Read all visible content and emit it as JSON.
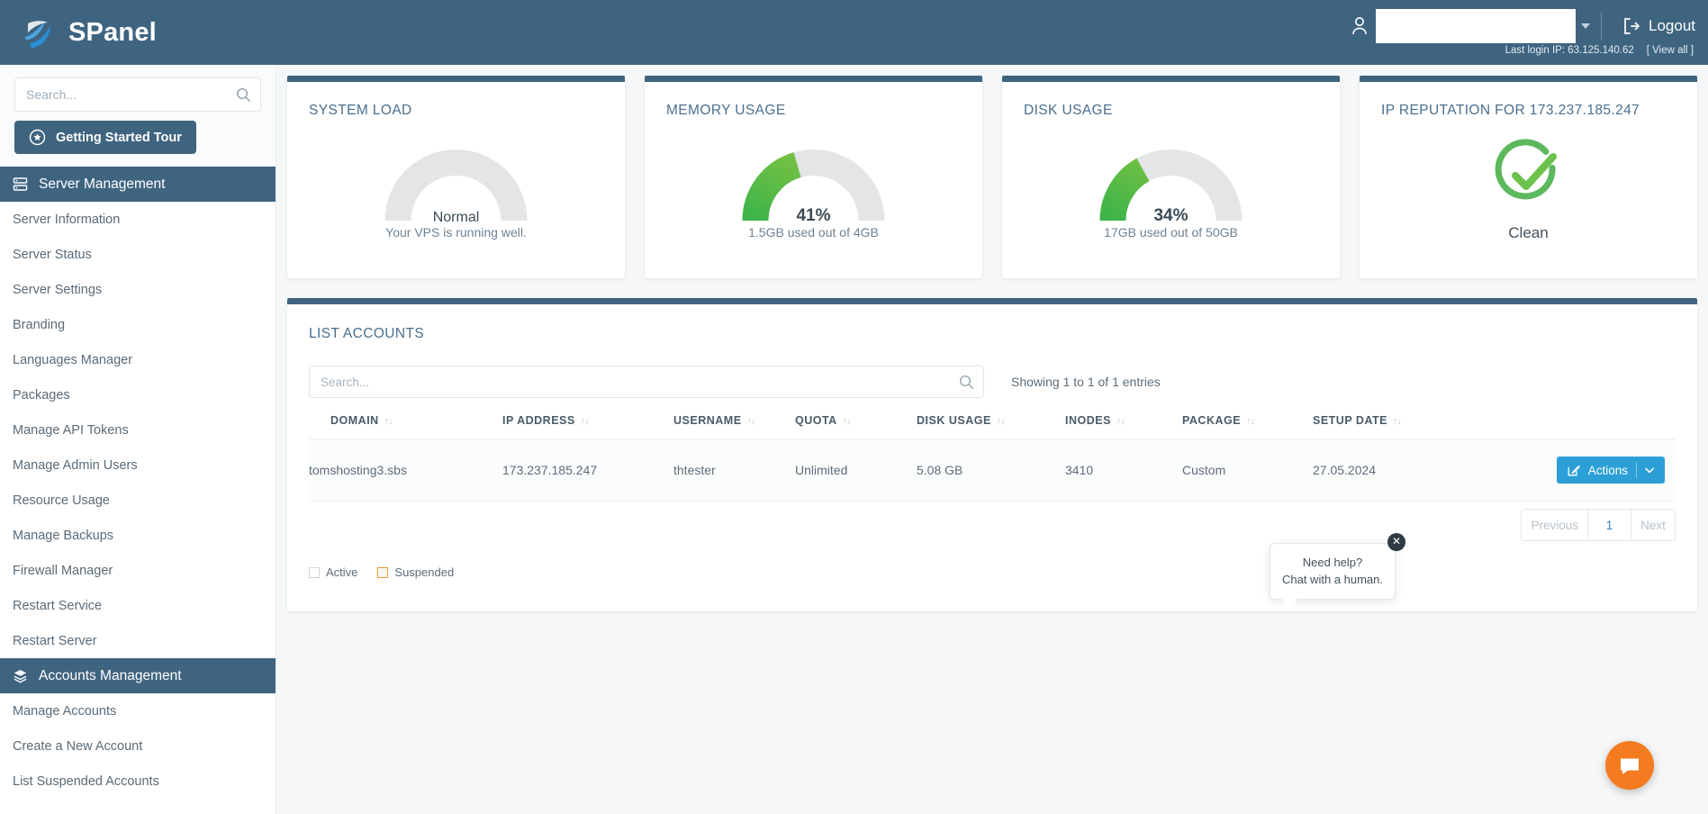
{
  "brand": {
    "name": "SPanel",
    "logo_icon": "spanel-logo-icon"
  },
  "topbar": {
    "user_icon": "user-icon",
    "user_select_value": "",
    "caret_icon": "chevron-down-icon",
    "logout_label": "Logout",
    "logout_icon": "logout-icon",
    "last_login_text": "Last login IP: 63.125.140.62",
    "view_all_label": "[ View all ]"
  },
  "sidebar": {
    "search_placeholder": "Search...",
    "search_value": "",
    "search_icon": "search-icon",
    "tour_button": {
      "label": "Getting Started Tour",
      "icon": "rocket-icon"
    },
    "groups": [
      {
        "label": "Server Management",
        "icon": "server-icon",
        "items": [
          "Server Information",
          "Server Status",
          "Server Settings",
          "Branding",
          "Languages Manager",
          "Packages",
          "Manage API Tokens",
          "Manage Admin Users",
          "Resource Usage",
          "Manage Backups",
          "Firewall Manager",
          "Restart Service",
          "Restart Server"
        ]
      },
      {
        "label": "Accounts Management",
        "icon": "layers-icon",
        "items": [
          "Manage Accounts",
          "Create a New Account",
          "List Suspended Accounts"
        ]
      }
    ]
  },
  "cards": [
    {
      "title": "SYSTEM LOAD",
      "type": "status-gauge",
      "percent": 0,
      "center_label": "Normal",
      "sub_label": "Your VPS is running well."
    },
    {
      "title": "MEMORY USAGE",
      "type": "percent-gauge",
      "percent": 41,
      "center_label": "41%",
      "sub_label": "1.5GB used out of 4GB"
    },
    {
      "title": "DISK USAGE",
      "type": "percent-gauge",
      "percent": 34,
      "center_label": "34%",
      "sub_label": "17GB used out of 50GB"
    },
    {
      "title": "IP REPUTATION FOR 173.237.185.247",
      "type": "reputation",
      "status_icon": "check-circle-icon",
      "status_label": "Clean"
    }
  ],
  "accounts_panel": {
    "title": "LIST ACCOUNTS",
    "search_placeholder": "Search...",
    "search_value": "",
    "search_icon": "search-icon",
    "entries_info": "Showing 1 to 1 of 1 entries",
    "sort_icon": "sort-updown-icon",
    "columns": [
      "DOMAIN",
      "IP ADDRESS",
      "USERNAME",
      "QUOTA",
      "DISK USAGE",
      "INODES",
      "PACKAGE",
      "SETUP DATE"
    ],
    "rows": [
      {
        "domain": "tomshosting3.sbs",
        "ip_address": "173.237.185.247",
        "username": "thtester",
        "quota": "Unlimited",
        "disk_usage": "5.08 GB",
        "inodes": "3410",
        "package": "Custom",
        "setup_date": "27.05.2024",
        "actions_label": "Actions",
        "actions_icon": "pencil-square-icon",
        "actions_caret": "chevron-down-icon"
      }
    ],
    "pagination": {
      "previous": "Previous",
      "page": "1",
      "next": "Next"
    },
    "legend": [
      {
        "label": "Active",
        "color": "#cfd7dd"
      },
      {
        "label": "Suspended",
        "color": "#f0932b"
      }
    ]
  },
  "chat": {
    "line1": "Need help?",
    "line2": "Chat with a human.",
    "close_icon": "close-icon",
    "fab_icon": "chat-bubble-icon"
  },
  "colors": {
    "header_blue": "#3f6480",
    "accent_blue": "#2b9fd6",
    "gauge_green_dark": "#4caf50",
    "gauge_green_light": "#8bc73f",
    "gauge_track": "#e3e5e6",
    "orange": "#f47b20"
  }
}
